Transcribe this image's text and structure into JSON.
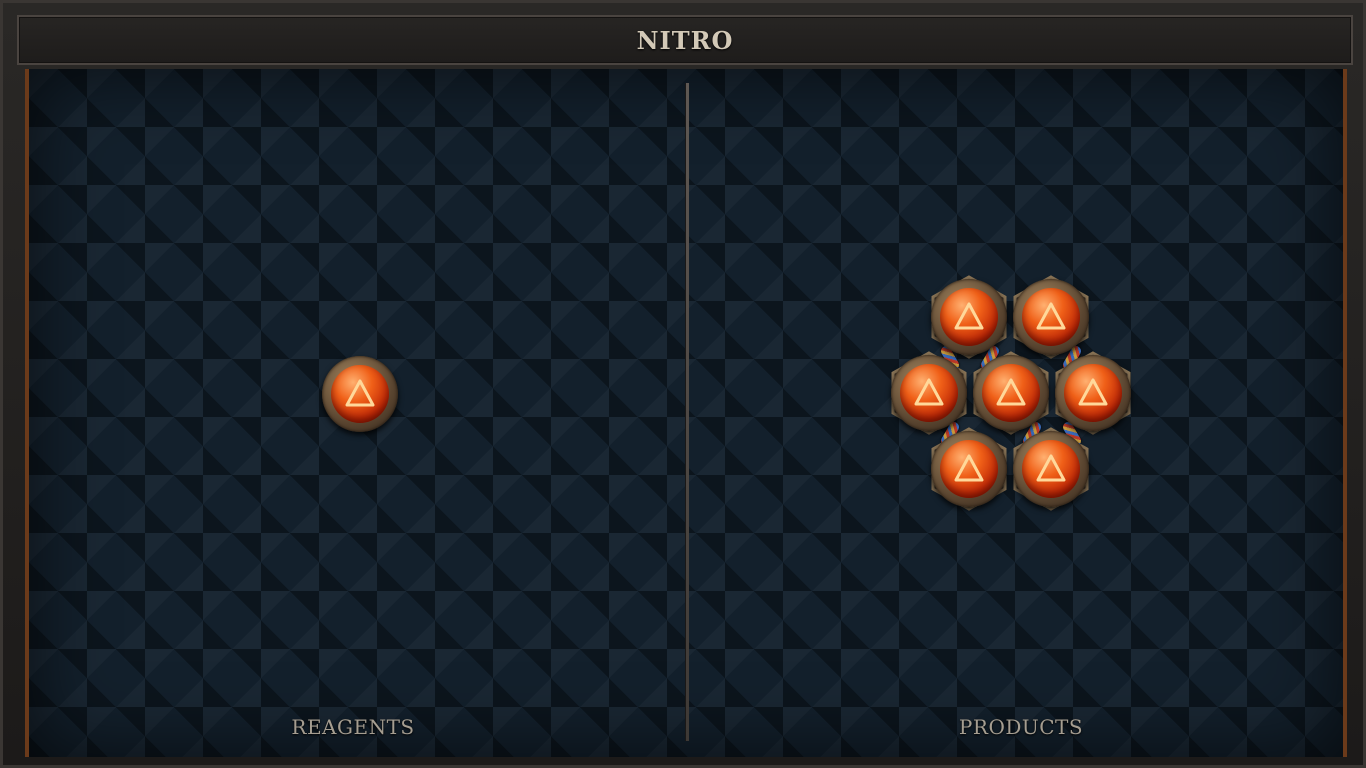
{
  "window": {
    "title": "NITRO"
  },
  "panels": {
    "left_label": "REAGENTS",
    "right_label": "PRODUCTS"
  },
  "reagents": [
    {
      "element": "fire",
      "icon": "fire-triangle-icon"
    }
  ],
  "products": [
    {
      "element": "fire",
      "icon": "fire-triangle-icon"
    },
    {
      "element": "fire",
      "icon": "fire-triangle-icon"
    },
    {
      "element": "fire",
      "icon": "fire-triangle-icon"
    },
    {
      "element": "fire",
      "icon": "fire-triangle-icon"
    },
    {
      "element": "fire",
      "icon": "fire-triangle-icon"
    },
    {
      "element": "fire",
      "icon": "fire-triangle-icon"
    },
    {
      "element": "fire",
      "icon": "fire-triangle-icon"
    }
  ],
  "colors": {
    "orb": "#e8501a",
    "frame_accent": "#6b3a1a",
    "background": "#13202c",
    "title_text": "#d3c9b7",
    "label_text": "#a59d90"
  }
}
